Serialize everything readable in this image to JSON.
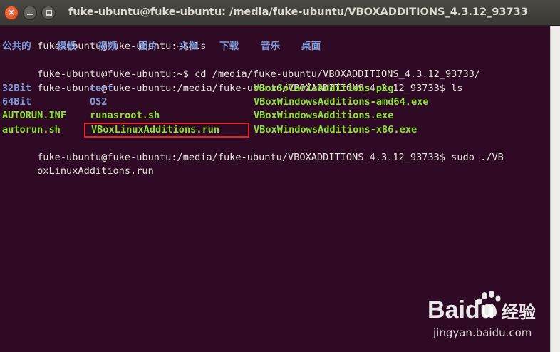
{
  "window": {
    "title": "fuke-ubuntu@fuke-ubuntu: /media/fuke-ubuntu/VBOXADDITIONS_4.3.12_93733",
    "buttons": {
      "close": "✕"
    }
  },
  "terminal": {
    "lines": [
      "fuke-ubuntu@fuke-ubuntu:~$ ls",
      "fuke-ubuntu@fuke-ubuntu:~$ cd /media/fuke-ubuntu/VBOXADDITIONS_4.3.12_93733/",
      "fuke-ubuntu@fuke-ubuntu:/media/fuke-ubuntu/VBOXADDITIONS_4.3.12_93733$ ls",
      "fuke-ubuntu@fuke-ubuntu:/media/fuke-ubuntu/VBOXADDITIONS_4.3.12_93733$ sudo ./VB",
      "oxLinuxAdditions.run"
    ],
    "home_dirs": [
      "公共的",
      "模板",
      "视频",
      "图片",
      "文档",
      "下载",
      "音乐",
      "桌面"
    ],
    "listing": {
      "row1": [
        "32Bit",
        "cert",
        "VBoxSolarisAdditions.pkg"
      ],
      "row2": [
        "64Bit",
        "OS2",
        "VBoxWindowsAdditions-amd64.exe"
      ],
      "row3": [
        "AUTORUN.INF",
        "runasroot.sh",
        "VBoxWindowsAdditions.exe"
      ],
      "row4": [
        "autorun.sh",
        "VBoxLinuxAdditions.run",
        "VBoxWindowsAdditions-x86.exe"
      ]
    }
  },
  "watermark": {
    "brand": "Baidu",
    "brand_cn": "经验",
    "url": "jingyan.baidu.com"
  },
  "colors": {
    "terminal_bg": "#2e0a24",
    "directory": "#7f9bd9",
    "executable": "#8ae234",
    "highlight": "#e02424"
  }
}
